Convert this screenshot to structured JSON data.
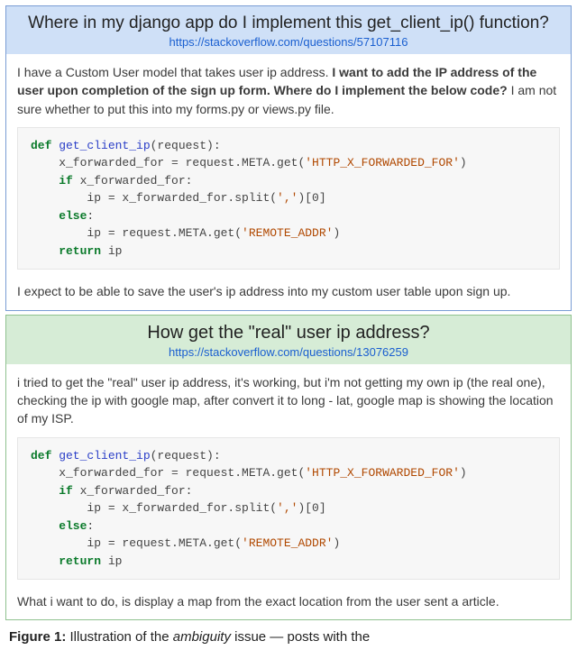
{
  "posts": [
    {
      "title": "Where in my django app do I implement this get_client_ip() function?",
      "url": "https://stackoverflow.com/questions/57107116",
      "intro_plain": "I have a Custom User model that takes user ip address. ",
      "intro_bold": "I want to add the IP address of the user upon completion of the sign up form. Where do I implement the below code?",
      "intro_tail": " I am not sure whether to put this into my forms.py or views.py file.",
      "expect": "I expect to be able to save the user's ip address into my custom user table upon sign up."
    },
    {
      "title": "How get the \"real\" user ip address?",
      "url": "https://stackoverflow.com/questions/13076259",
      "intro": "i tried to get the \"real\" user ip address, it's working, but i'm not getting my own ip (the real one), checking the ip with google map, after convert it to long - lat, google map is showing the location of my ISP.",
      "expect": "What i want to do, is display a map from the exact location from the user sent a article."
    }
  ],
  "code": {
    "l1a": "def",
    "l1b": " get_client_ip",
    "l1c": "(request):",
    "l2a": "    x_forwarded_for = request.META.get(",
    "l2b": "'HTTP_X_FORWARDED_FOR'",
    "l2c": ")",
    "l3a": "    if",
    "l3b": " x_forwarded_for:",
    "l4a": "        ip = x_forwarded_for.split(",
    "l4b": "','",
    "l4c": ")[0]",
    "l5a": "    else",
    "l5b": ":",
    "l6a": "        ip = request.META.get(",
    "l6b": "'REMOTE_ADDR'",
    "l6c": ")",
    "l7a": "    return",
    "l7b": " ip"
  },
  "caption": {
    "label": "Figure 1:",
    "text_a": "  Illustration of the ",
    "text_em": "ambiguity",
    "text_b": " issue — posts with the"
  }
}
